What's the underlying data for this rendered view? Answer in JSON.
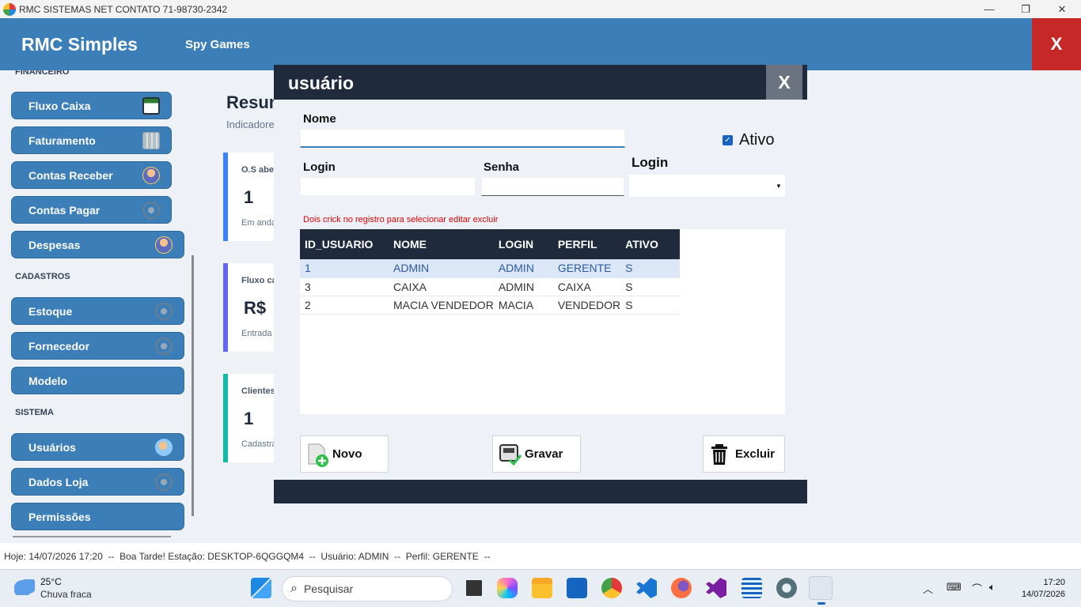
{
  "window": {
    "title": "RMC SISTEMAS NET CONTATO 71-98730-2342",
    "minimize": "—",
    "restore": "❐",
    "close": "✕"
  },
  "header": {
    "brand": "RMC Simples",
    "store": "Spy Games",
    "close_label": "X"
  },
  "sidebar": {
    "sections": {
      "financeiro": "FINANCEIRO",
      "cadastros": "CADASTROS",
      "sistema": "SISTEMA"
    },
    "items": [
      {
        "label": "Fluxo Caixa",
        "icon": "calculator-icon"
      },
      {
        "label": "Faturamento",
        "icon": "calendar-icon"
      },
      {
        "label": "Contas Receber",
        "icon": "person-money-icon"
      },
      {
        "label": "Contas Pagar",
        "icon": "tools-icon"
      },
      {
        "label": "Despesas",
        "icon": "person-money-icon"
      },
      {
        "label": "Estoque",
        "icon": "tools-icon"
      },
      {
        "label": "Fornecedor",
        "icon": "tools-icon"
      },
      {
        "label": "Modelo",
        "icon": ""
      },
      {
        "label": "Usuários",
        "icon": "users-icon"
      },
      {
        "label": "Dados Loja",
        "icon": "tools-icon"
      },
      {
        "label": "Permissões",
        "icon": ""
      }
    ]
  },
  "dashboard": {
    "title": "Resum",
    "subtitle": "Indicadore",
    "cards": [
      {
        "title": "O.S abe",
        "value": "1",
        "sub": "Em anda",
        "color": "#3b82f6"
      },
      {
        "title": "Fluxo ca",
        "value": "R$",
        "sub": "Entrada",
        "color": "#6366f1"
      },
      {
        "title": "Clientes",
        "value": "1",
        "sub": "Cadastra",
        "color": "#14b8a6"
      }
    ]
  },
  "modal": {
    "title": "usuário",
    "close_label": "X",
    "fields": {
      "nome_label": "Nome",
      "nome_value": "",
      "login_label": "Login",
      "login_value": "",
      "senha_label": "Senha",
      "senha_value": "",
      "perfil_label": "Login",
      "perfil_value": "",
      "ativo_label": "Ativo",
      "ativo_checked": true
    },
    "hint": "Dois crick no registro para selecionar editar excluir",
    "table": {
      "columns": [
        "ID_USUARIO",
        "NOME",
        "LOGIN",
        "PERFIL",
        "ATIVO"
      ],
      "rows": [
        [
          "1",
          "ADMIN",
          "ADMIN",
          "GERENTE",
          "S"
        ],
        [
          "3",
          "CAIXA",
          "ADMIN",
          "CAIXA",
          "S"
        ],
        [
          "2",
          "MACIA VENDEDOR",
          "MACIA",
          "VENDEDOR",
          "S"
        ]
      ],
      "selected_row": 0
    },
    "buttons": {
      "novo": "Novo",
      "gravar": "Gravar",
      "excluir": "Excluir"
    }
  },
  "status": {
    "text": "Hoje: 14/07/2026 17:20  --  Boa Tarde! Estação: DESKTOP-6QGGQM4  --  Usuário: ADMIN  --  Perfil: GERENTE  --"
  },
  "taskbar": {
    "weather_temp": "25°C",
    "weather_desc": "Chuva fraca",
    "search_placeholder": "Pesquisar",
    "time": "17:20",
    "date": "14/07/2026"
  }
}
